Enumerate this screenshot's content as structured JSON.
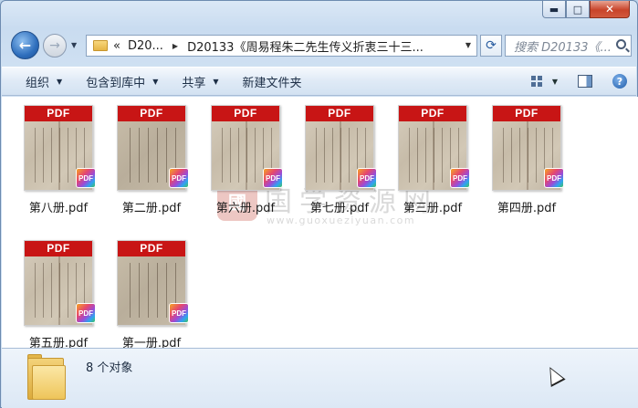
{
  "window": {
    "caption": {
      "minimize": "▬",
      "maximize": "□",
      "close": "✕"
    }
  },
  "nav": {
    "back_glyph": "←",
    "forward_glyph": "→",
    "history_dd": "▼",
    "address": {
      "chevrons": "«",
      "crumb_parent": "D20...",
      "crumb_sep": "▶",
      "crumb_current": "D20133《周易程朱二先生传义折衷三十三...",
      "dropdown": "▼"
    },
    "refresh_glyph": "⟳",
    "search": {
      "placeholder": "搜索 D20133《..."
    }
  },
  "toolbar": {
    "organize": "组织",
    "include_library": "包含到库中",
    "share": "共享",
    "new_folder": "新建文件夹",
    "arrow": "▼",
    "help": "?"
  },
  "files": [
    {
      "name": "第八册.pdf",
      "band": "PDF",
      "badge": "PDF"
    },
    {
      "name": "第二册.pdf",
      "band": "PDF",
      "badge": "PDF"
    },
    {
      "name": "第六册.pdf",
      "band": "PDF",
      "badge": "PDF"
    },
    {
      "name": "第七册.pdf",
      "band": "PDF",
      "badge": "PDF"
    },
    {
      "name": "第三册.pdf",
      "band": "PDF",
      "badge": "PDF"
    },
    {
      "name": "第四册.pdf",
      "band": "PDF",
      "badge": "PDF"
    },
    {
      "name": "第五册.pdf",
      "band": "PDF",
      "badge": "PDF"
    },
    {
      "name": "第一册.pdf",
      "band": "PDF",
      "badge": "PDF"
    }
  ],
  "watermark": {
    "seal": "國",
    "title": "国学资源网",
    "url": "www.guoxueziyuan.com"
  },
  "details": {
    "count": "8 个对象"
  }
}
